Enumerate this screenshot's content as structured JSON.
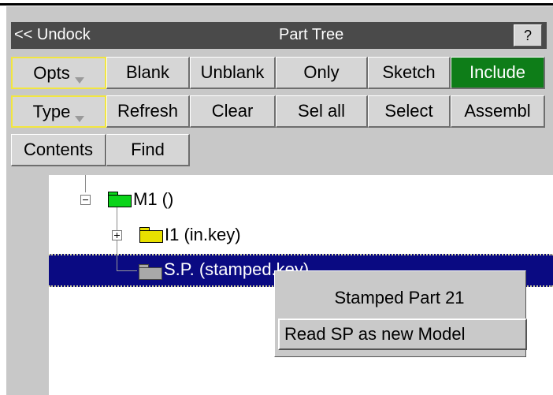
{
  "header": {
    "undock": "<< Undock",
    "title": "Part Tree",
    "help": "?"
  },
  "buttons": {
    "row1": [
      "Opts",
      "Blank",
      "Unblank",
      "Only",
      "Sketch",
      "Include"
    ],
    "row2": [
      "Type",
      "Refresh",
      "Clear",
      "Sel all",
      "Select",
      "Assembl"
    ],
    "row3": [
      "Contents",
      "Find"
    ]
  },
  "tree": {
    "root": "M1 ()",
    "child1": "I1 (in.key)",
    "child2": "S.P. (stamped.key)"
  },
  "context_menu": {
    "item1": "Stamped Part 21",
    "item2": "Read SP as new Model"
  },
  "colors": {
    "include_active": "#0e7d18",
    "selection": "#0a0a82",
    "root_folder": "#0bd41a",
    "include_folder": "#e8e000",
    "sp_folder": "#a8a8a8"
  }
}
